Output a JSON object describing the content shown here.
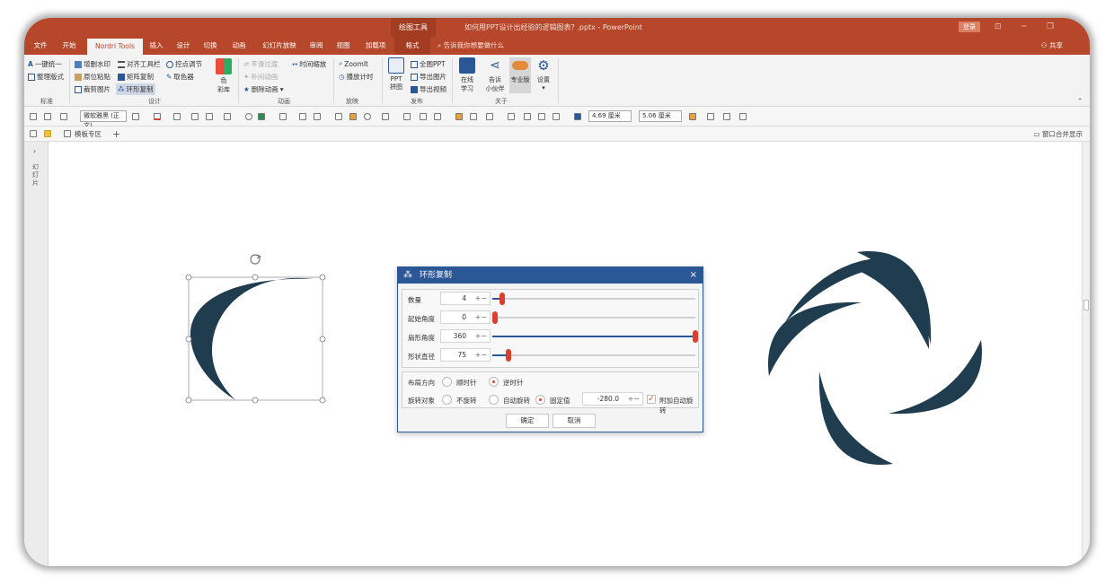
{
  "titlebar": {
    "context_tab": "绘图工具",
    "document_title": "如何用PPT设计出经验的逻辑图表? .pptx  -  PowerPoint",
    "login": "登录",
    "share": "共享"
  },
  "tabs": {
    "file": "文件",
    "home": "开始",
    "nordri": "Nordri Tools",
    "insert": "插入",
    "design": "设计",
    "transitions": "切换",
    "animations": "动画",
    "slideshow": "幻灯片放映",
    "review": "审阅",
    "view": "视图",
    "addins": "加载项",
    "format": "格式",
    "tell_me": "告诉我你想要做什么"
  },
  "ribbon": {
    "standard": {
      "one_key": "一键统一",
      "organize": "整理版式",
      "label": "标准"
    },
    "design_group": {
      "watermark": "增删水印",
      "paste_in_place": "原位粘贴",
      "crop_image": "裁剪图片",
      "align_toolbar": "对齐工具栏",
      "matrix_copy": "矩阵复制",
      "ring_copy": "环形复制",
      "control_points": "控点调节",
      "color_picker": "取色器",
      "color_lib_top": "色",
      "color_lib_bottom": "彩库",
      "label": "设计"
    },
    "animation": {
      "smooth": "平滑过渡",
      "fill": "补间动画",
      "delete": "删除动画",
      "timeline": "时间缩放",
      "label": "动画"
    },
    "playback": {
      "zoomit": "ZoomIt",
      "timer": "播放计时",
      "label": "放映"
    },
    "publish": {
      "ppt_top": "PPT",
      "ppt_bottom": "拼图",
      "full_ppt": "全图PPT",
      "export_image": "导出图片",
      "export_video": "导出视频",
      "label": "发布"
    },
    "about": {
      "online_top": "在线",
      "online_bottom": "学习",
      "tell_top": "告诉",
      "tell_bottom": "小伙伴",
      "pro": "专业版",
      "settings": "设置",
      "label": "关于"
    }
  },
  "toolbar": {
    "font": "微软雅黑 (正文)",
    "height": "4.69 厘米",
    "width": "5.06 厘米"
  },
  "secondary": {
    "template_zone": "模板专区",
    "merge_windows": "窗口合并显示"
  },
  "sidepane": {
    "label": "幻灯片"
  },
  "dialog": {
    "title": "环形复制",
    "count_label": "数量",
    "count_value": "4",
    "count_fraction": 0.05,
    "start_angle_label": "起始角度",
    "start_angle_value": "0",
    "start_angle_fraction": 0.0,
    "sector_angle_label": "扇形角度",
    "sector_angle_value": "360",
    "sector_angle_fraction": 1.0,
    "diameter_label": "形状直径",
    "diameter_value": "75",
    "diameter_fraction": 0.08,
    "layout_label": "布局方向",
    "clockwise": "顺时针",
    "counterclockwise": "逆时针",
    "rotate_label": "旋转对象",
    "no_rotate": "不旋转",
    "auto_rotate": "自动旋转",
    "fixed_value": "固定值",
    "fixed_number": "-280.0",
    "extra_rotate": "附加自动旋转",
    "ok": "确定",
    "cancel": "取消"
  },
  "colors": {
    "title_bar": "#b7472a",
    "shape_fill": "#1f3d4f",
    "dialog_accent": "#2b5797",
    "slider_thumb": "#d9412e"
  }
}
